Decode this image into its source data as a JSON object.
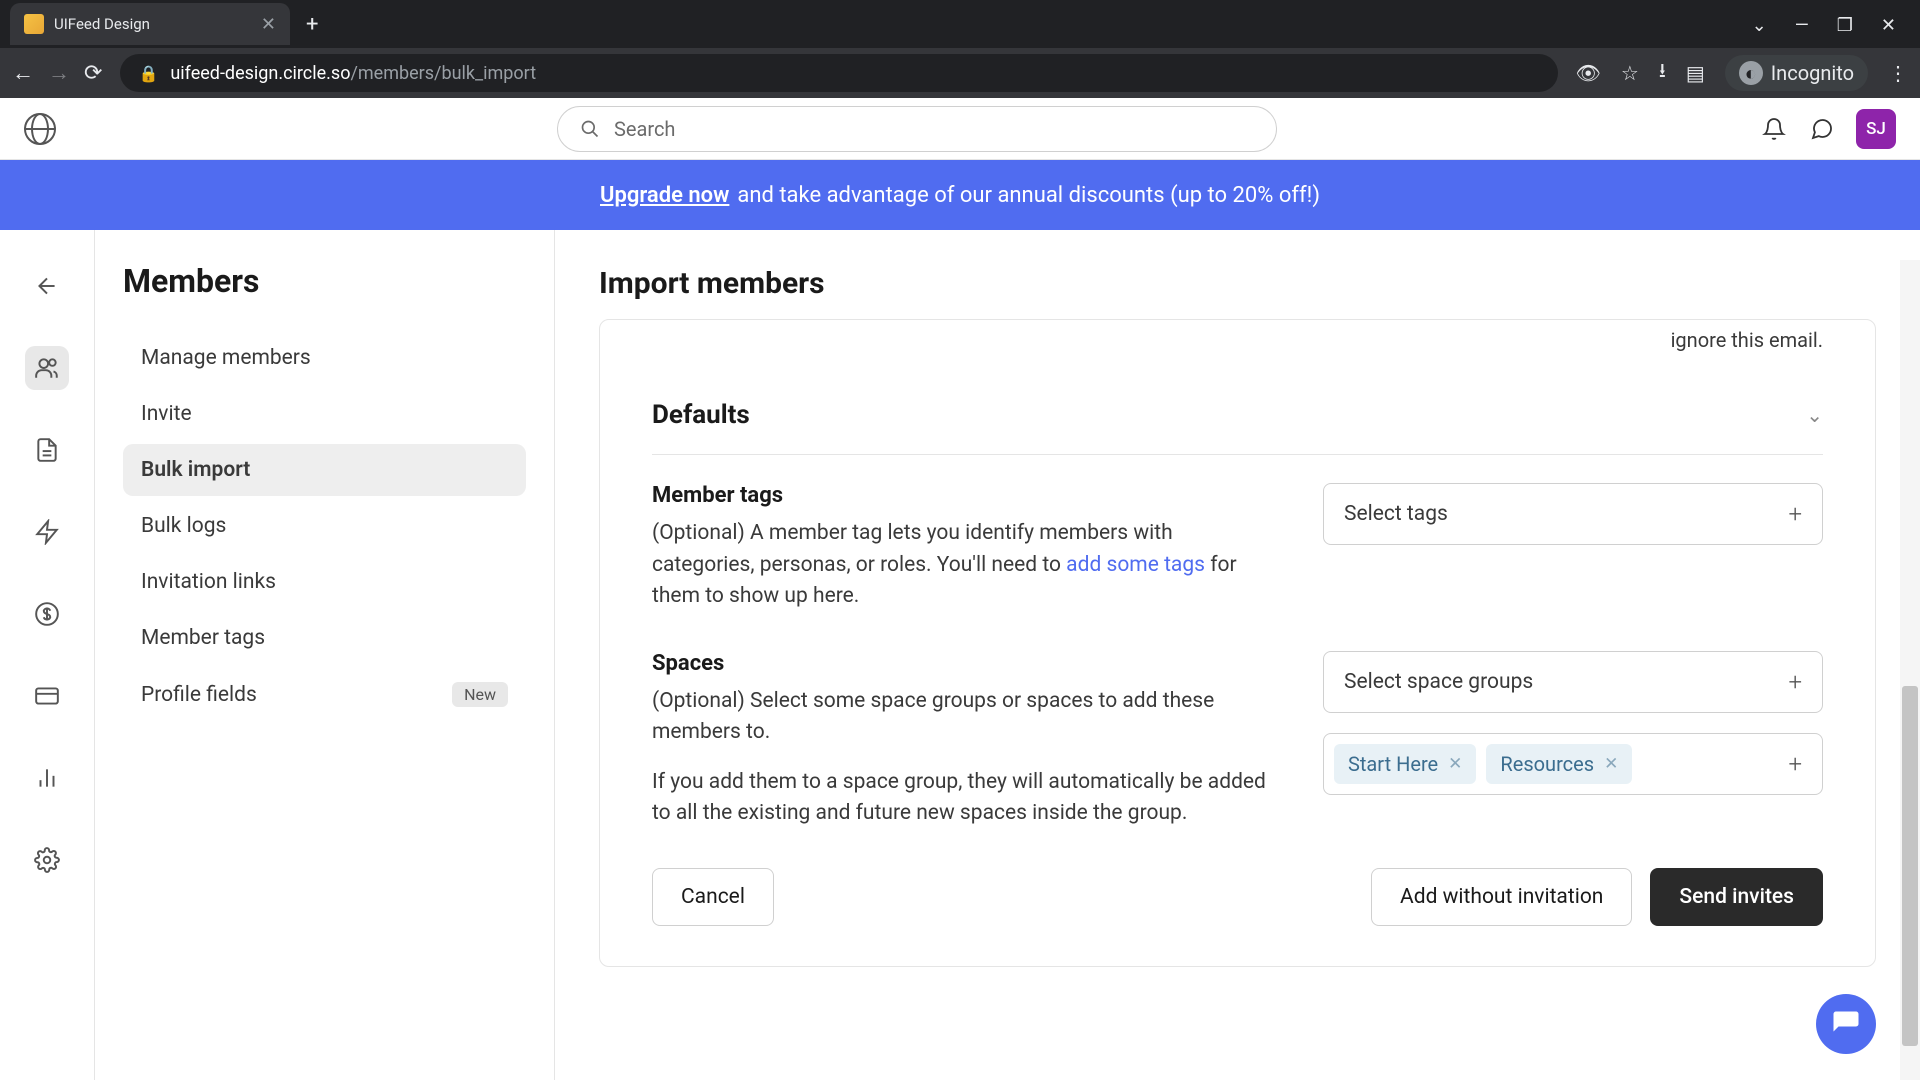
{
  "browser": {
    "tab_title": "UIFeed Design",
    "url_domain": "uifeed-design.circle.so",
    "url_path": "/members/bulk_import",
    "incognito_label": "Incognito"
  },
  "header": {
    "search_placeholder": "Search",
    "avatar_initials": "SJ"
  },
  "banner": {
    "link": "Upgrade now",
    "text": " and take advantage of our annual discounts (up to 20% off!)"
  },
  "sidebar": {
    "title": "Members",
    "items": [
      {
        "label": "Manage members"
      },
      {
        "label": "Invite"
      },
      {
        "label": "Bulk import"
      },
      {
        "label": "Bulk logs"
      },
      {
        "label": "Invitation links"
      },
      {
        "label": "Member tags"
      },
      {
        "label": "Profile fields",
        "badge": "New"
      }
    ]
  },
  "main": {
    "title": "Import members",
    "truncated": "ignore this email.",
    "defaults": {
      "heading": "Defaults",
      "member_tags": {
        "label": "Member tags",
        "desc_before": "(Optional) A member tag lets you identify members with categories, personas, or roles. You'll need to ",
        "desc_link": "add some tags",
        "desc_after": " for them to show up here.",
        "select_placeholder": "Select tags"
      },
      "spaces": {
        "label": "Spaces",
        "desc1": "(Optional) Select some space groups or spaces to add these members to.",
        "desc2": "If you add them to a space group, they will automatically be added to all the existing and future new spaces inside the group.",
        "select_placeholder": "Select space groups",
        "selected": [
          "Start Here",
          "Resources"
        ]
      }
    },
    "actions": {
      "cancel": "Cancel",
      "add_without": "Add without invitation",
      "send": "Send invites"
    }
  }
}
